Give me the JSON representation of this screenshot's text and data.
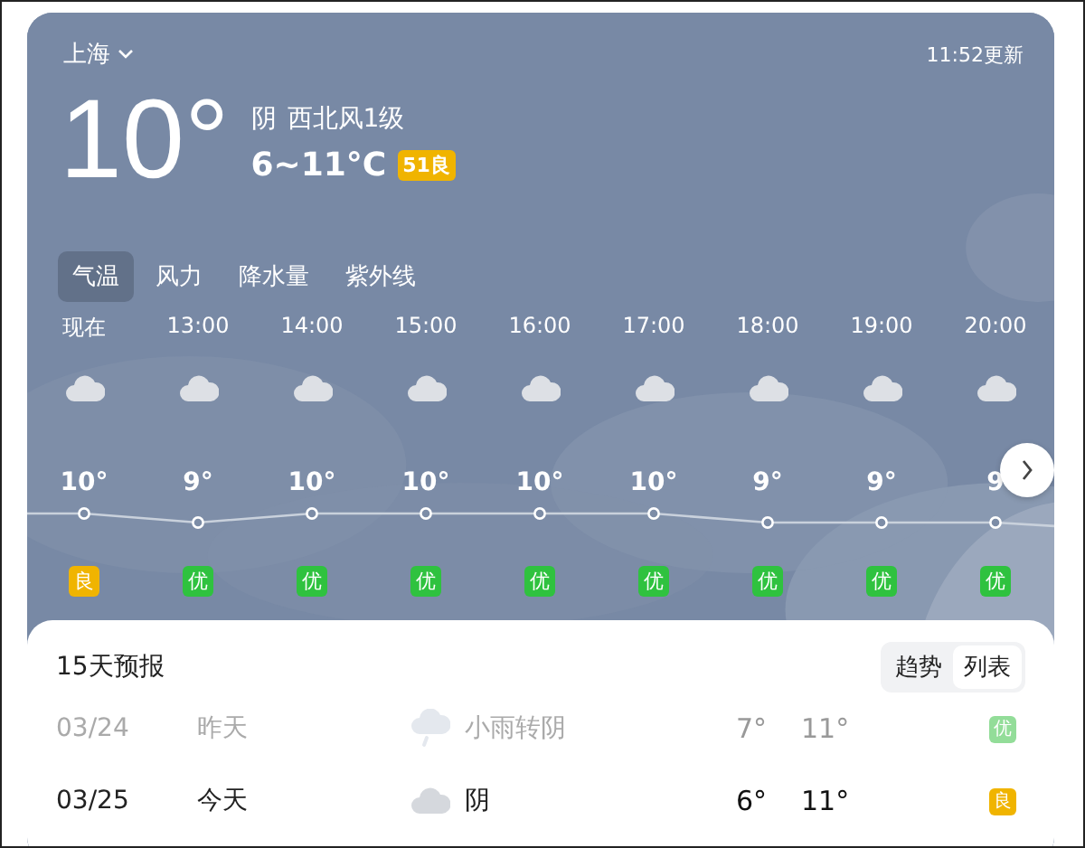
{
  "location": {
    "city": "上海",
    "updated": "11:52更新"
  },
  "current": {
    "temp": "10°",
    "condition": "阴",
    "wind": "西北风1级",
    "range": "6~11°C",
    "aqi": {
      "value": "51",
      "label": "良",
      "color": "#f0b400"
    }
  },
  "tabs": [
    {
      "label": "气温",
      "selected": true
    },
    {
      "label": "风力",
      "selected": false
    },
    {
      "label": "降水量",
      "selected": false
    },
    {
      "label": "紫外线",
      "selected": false
    }
  ],
  "hourly": [
    {
      "time": "现在",
      "temp": "10°",
      "aqi": "良",
      "color": "#f0b400"
    },
    {
      "time": "13:00",
      "temp": "9°",
      "aqi": "优",
      "color": "#2fc23f"
    },
    {
      "time": "14:00",
      "temp": "10°",
      "aqi": "优",
      "color": "#2fc23f"
    },
    {
      "time": "15:00",
      "temp": "10°",
      "aqi": "优",
      "color": "#2fc23f"
    },
    {
      "time": "16:00",
      "temp": "10°",
      "aqi": "优",
      "color": "#2fc23f"
    },
    {
      "time": "17:00",
      "temp": "10°",
      "aqi": "优",
      "color": "#2fc23f"
    },
    {
      "time": "18:00",
      "temp": "9°",
      "aqi": "优",
      "color": "#2fc23f"
    },
    {
      "time": "19:00",
      "temp": "9°",
      "aqi": "优",
      "color": "#2fc23f"
    },
    {
      "time": "20:00",
      "temp": "9",
      "aqi": "优",
      "color": "#2fc23f"
    }
  ],
  "forecast": {
    "title": "15天预报",
    "views": [
      {
        "label": "趋势",
        "selected": false
      },
      {
        "label": "列表",
        "selected": true
      }
    ],
    "days": [
      {
        "date": "03/24",
        "day": "昨天",
        "kind": "rain",
        "condition": "小雨转阴",
        "low": "7°",
        "high": "11°",
        "aqi": "优",
        "color": "#93dd99",
        "past": true
      },
      {
        "date": "03/25",
        "day": "今天",
        "kind": "cloud",
        "condition": "阴",
        "low": "6°",
        "high": "11°",
        "aqi": "良",
        "color": "#f0b400",
        "past": false
      }
    ]
  }
}
